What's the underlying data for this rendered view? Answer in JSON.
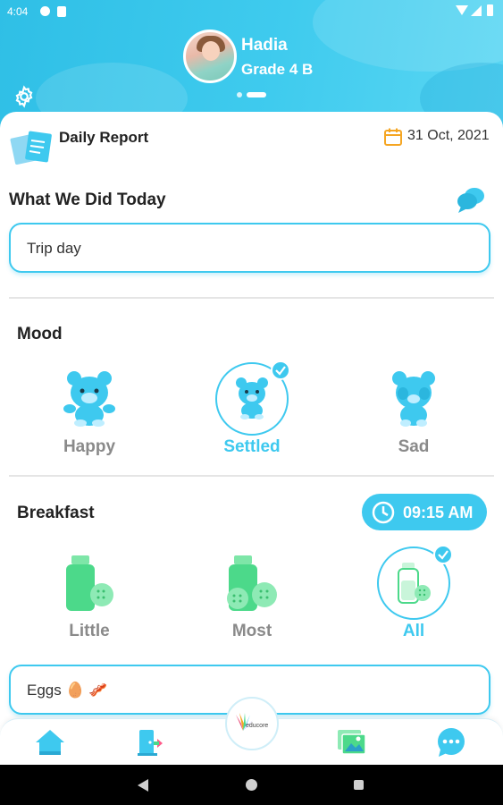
{
  "status_bar": {
    "time": "4:04"
  },
  "profile": {
    "name": "Hadia",
    "grade": "Grade 4 B"
  },
  "report": {
    "title": "Daily Report",
    "date": "31 Oct, 2021"
  },
  "activities": {
    "title": "What We Did Today",
    "value": "Trip day"
  },
  "mood": {
    "title": "Mood",
    "options": [
      {
        "label": "Happy",
        "selected": false
      },
      {
        "label": "Settled",
        "selected": true
      },
      {
        "label": "Sad",
        "selected": false
      }
    ]
  },
  "breakfast": {
    "title": "Breakfast",
    "time": "09:15 AM",
    "options": [
      {
        "label": "Little",
        "selected": false
      },
      {
        "label": "Most",
        "selected": false
      },
      {
        "label": "All",
        "selected": true
      }
    ],
    "note": "Eggs 🥚 🥓"
  },
  "bottom_nav": {
    "items": [
      {
        "icon": "home-icon"
      },
      {
        "icon": "door-exit-icon"
      },
      {
        "icon": "educore-logo"
      },
      {
        "icon": "gallery-icon"
      },
      {
        "icon": "chat-icon"
      }
    ],
    "logo_text": "educore"
  },
  "colors": {
    "accent": "#3ec9ef",
    "header": "#3fcbee",
    "food_green": "#4cd98a"
  }
}
